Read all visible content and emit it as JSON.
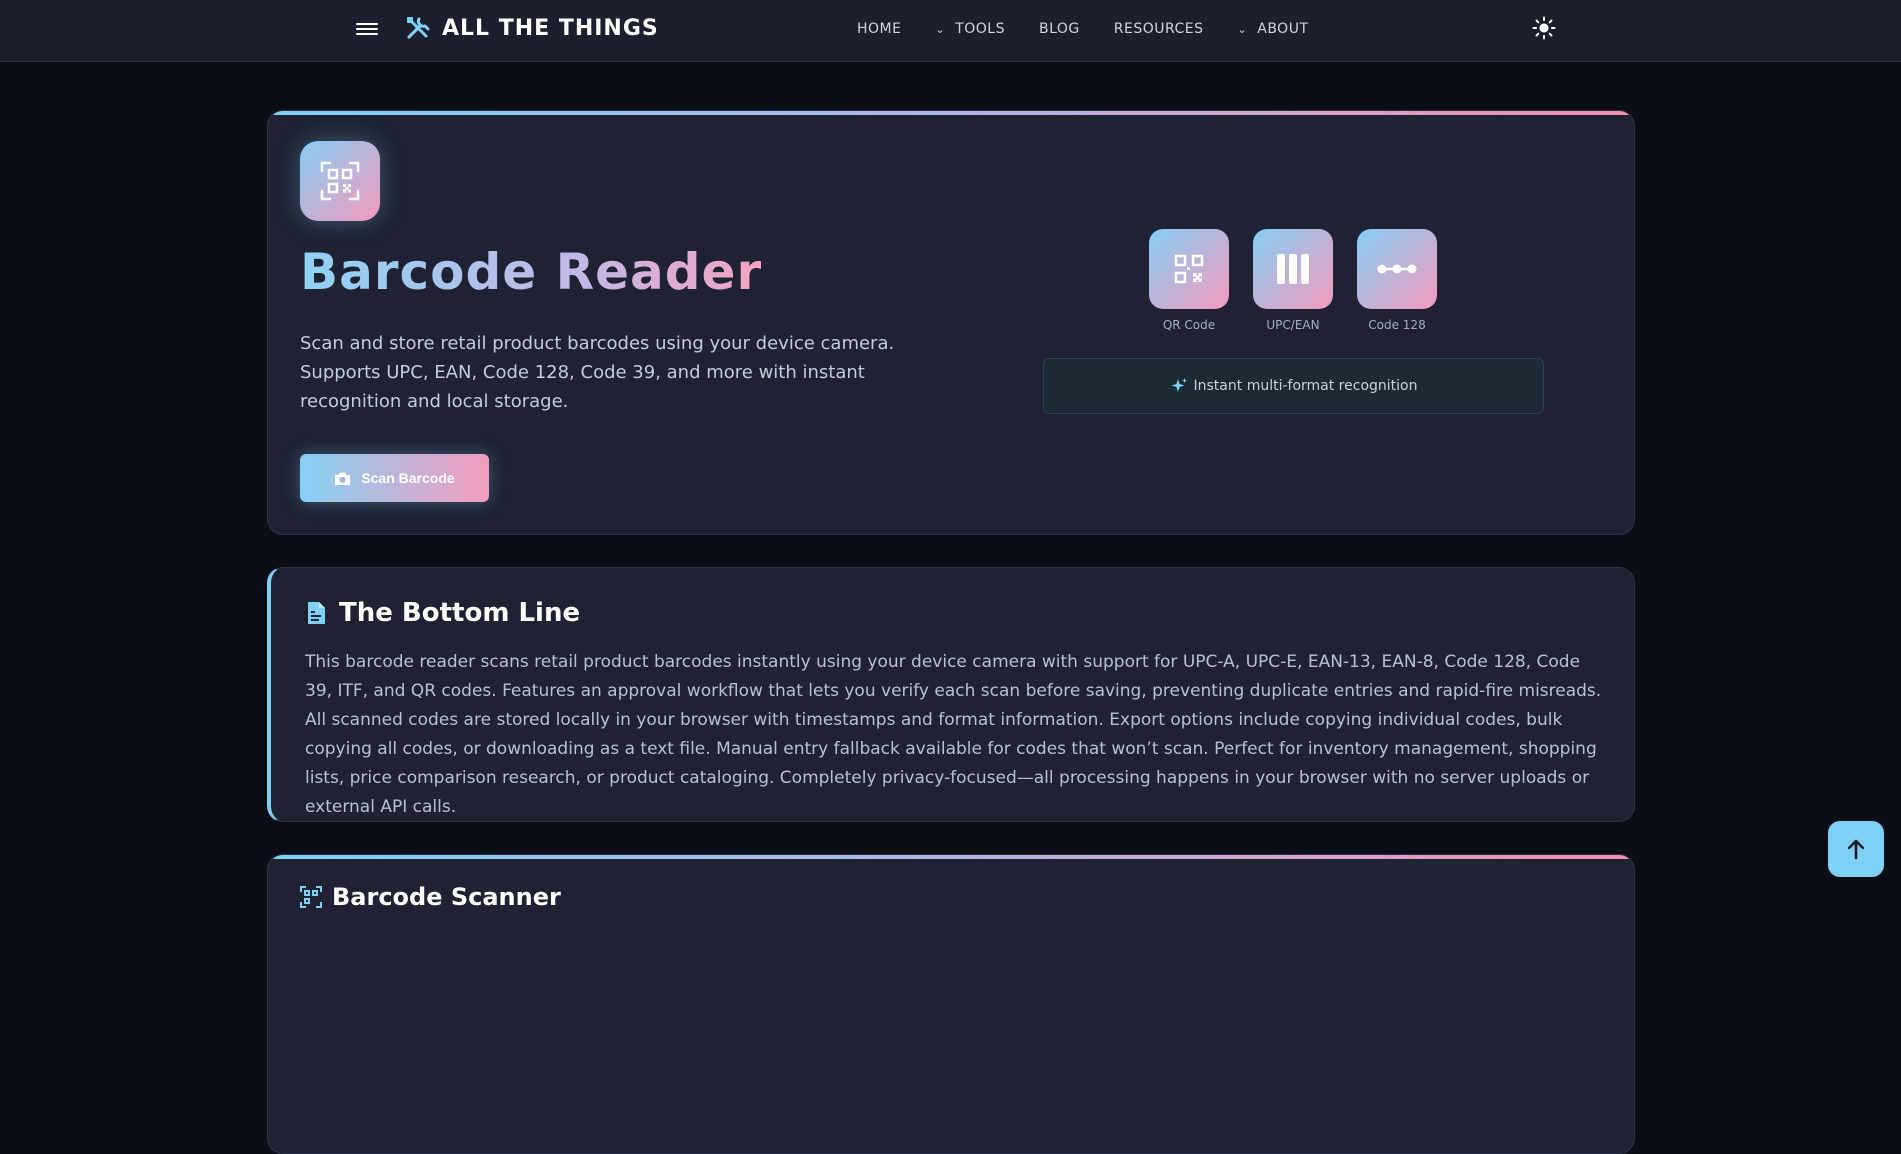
{
  "nav": {
    "brand": "ALL THE THINGS",
    "items": [
      {
        "label": "HOME",
        "has_chevron": false
      },
      {
        "label": "TOOLS",
        "has_chevron": true
      },
      {
        "label": "BLOG",
        "has_chevron": false
      },
      {
        "label": "RESOURCES",
        "has_chevron": false
      },
      {
        "label": "ABOUT",
        "has_chevron": true
      }
    ],
    "icons": {
      "menu": "hamburger-icon",
      "brand": "tools-icon",
      "theme": "sun-icon"
    }
  },
  "hero": {
    "title": "Barcode Reader",
    "description": "Scan and store retail product barcodes using your device camera. Supports UPC, EAN, Code 128, Code 39, and more with instant recognition and local storage.",
    "button_label": "Scan Barcode",
    "formats": [
      {
        "label": "QR Code",
        "icon": "qr-code-icon"
      },
      {
        "label": "UPC/EAN",
        "icon": "barcode-icon"
      },
      {
        "label": "Code 128",
        "icon": "dots-line-icon"
      }
    ],
    "recognition": "Instant multi-format recognition"
  },
  "bottom_line": {
    "title": "The Bottom Line",
    "body": "This barcode reader scans retail product barcodes instantly using your device camera with support for UPC-A, UPC-E, EAN-13, EAN-8, Code 128, Code 39, ITF, and QR codes. Features an approval workflow that lets you verify each scan before saving, preventing duplicate entries and rapid-fire misreads. All scanned codes are stored locally in your browser with timestamps and format information. Export options include copying individual codes, bulk copying all codes, or downloading as a text file. Manual entry fallback available for codes that won’t scan. Perfect for inventory management, shopping lists, price comparison research, or product cataloging. Completely privacy-focused—all processing happens in your browser with no server uploads or external API calls."
  },
  "scanner": {
    "title": "Barcode Scanner"
  },
  "colors": {
    "accent_blue": "#7fd0f5",
    "accent_pink": "#f39bbd",
    "background": "#0b0e17",
    "card": "#1e2232"
  }
}
